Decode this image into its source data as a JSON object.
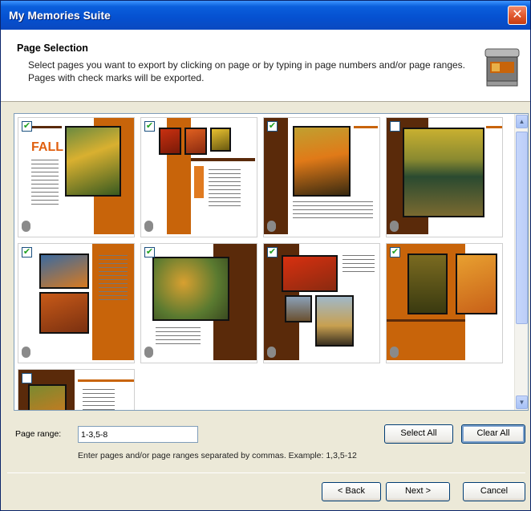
{
  "window": {
    "title": "My Memories Suite",
    "close_glyph": "✕"
  },
  "header": {
    "title": "Page Selection",
    "description": "Select pages you want to export by clicking on page or by typing in page numbers and/or page ranges. Pages with check marks will be exported.",
    "icon": "scanner-icon"
  },
  "pages": [
    {
      "checked": true
    },
    {
      "checked": true
    },
    {
      "checked": true
    },
    {
      "checked": false
    },
    {
      "checked": true
    },
    {
      "checked": true
    },
    {
      "checked": true
    },
    {
      "checked": true
    },
    {
      "checked": false
    }
  ],
  "thumb_text": {
    "fall": "FALL"
  },
  "page_range": {
    "label": "Page range:",
    "value": "1-3,5-8",
    "hint": "Enter pages and/or page ranges separated by commas. Example: 1,3,5-12"
  },
  "buttons": {
    "select_all": "Select All",
    "clear_all": "Clear All",
    "back": "< Back",
    "next": "Next >",
    "cancel": "Cancel"
  },
  "scrollbar": {
    "up_glyph": "▲",
    "down_glyph": "▼"
  },
  "colors": {
    "accent_orange": "#c8640a",
    "accent_brown": "#5a2a0a",
    "title_blue": "#0550d0"
  }
}
